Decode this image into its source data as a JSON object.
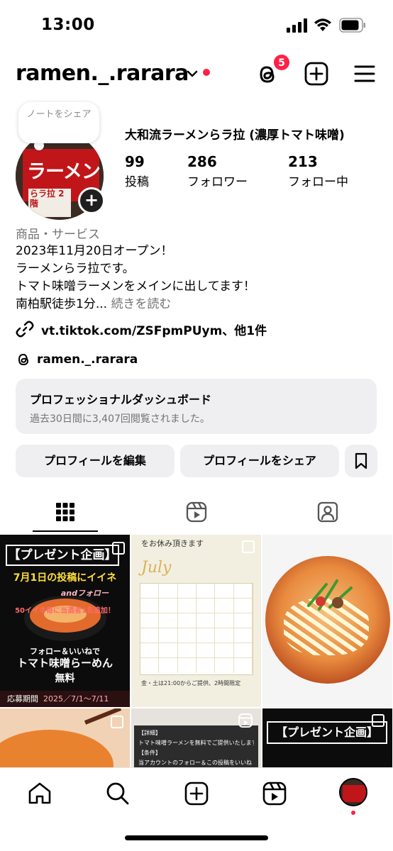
{
  "status_bar": {
    "time": "13:00"
  },
  "header": {
    "username": "ramen._.rarara",
    "threads_badge": "5"
  },
  "profile": {
    "note_bubble": "ノートをシェア",
    "display_name": "大和流ラーメンらラ拉 (濃厚トマト味噌)",
    "avatar_text": "ラーメン",
    "avatar_sub": "らラ拉 2階",
    "stats": [
      {
        "value": "99",
        "label": "投稿"
      },
      {
        "value": "286",
        "label": "フォロワー"
      },
      {
        "value": "213",
        "label": "フォロー中"
      }
    ],
    "category": "商品・サービス",
    "bio": [
      "2023年11月20日オープン！",
      "ラーメンらラ拉です。",
      "トマト味噌ラーメンをメインに出してます！",
      "南柏駅徒歩1分..."
    ],
    "bio_more": "続きを読む",
    "link": "vt.tiktok.com/ZSFpmPUym、他1件",
    "threads_handle": "ramen._.rarara"
  },
  "dashboard": {
    "title": "プロフェッショナルダッシュボード",
    "subtitle": "過去30日間に3,407回閲覧されました。"
  },
  "buttons": {
    "edit_profile": "プロフィールを編集",
    "share_profile": "プロフィールをシェア"
  },
  "grid": {
    "post1": {
      "banner": "【プレゼント企画】",
      "line1": "7月1日の投稿にイイネ",
      "line2": "andフォロー",
      "line3": "50イイネ毎に当選者1名追加！",
      "line4": "フォロー＆いいねで",
      "line5": "トマト味噌らーめん",
      "line6": "無料",
      "footer_label": "応募期間",
      "footer_dates": "2025／7/1〜7/11"
    },
    "post2": {
      "header": "をお休み頂きます",
      "month": "July",
      "footer": "金・土は21:00からご提供、2時間限定"
    },
    "post4": {
      "label": ""
    },
    "post5": {
      "line1": "【詳細】",
      "line2": "トマト味噌ラーメンを無料でご提供いたします",
      "line3": "【条件】",
      "line4": "当アカウントのフォロー＆この投稿をいいね"
    },
    "post6": {
      "banner": "【プレゼント企画】"
    }
  },
  "colors": {
    "accent_red": "#ff2046",
    "button_bg": "#efeff2",
    "secondary_text": "#737373"
  },
  "icons": {
    "threads": "threads-icon",
    "create": "plus-square-icon",
    "menu": "hamburger-menu-icon",
    "link": "link-icon",
    "bookmark": "bookmark-icon",
    "grid": "grid-icon",
    "reels": "reels-icon",
    "tagged": "tagged-person-icon",
    "home": "home-icon",
    "search": "search-icon"
  }
}
